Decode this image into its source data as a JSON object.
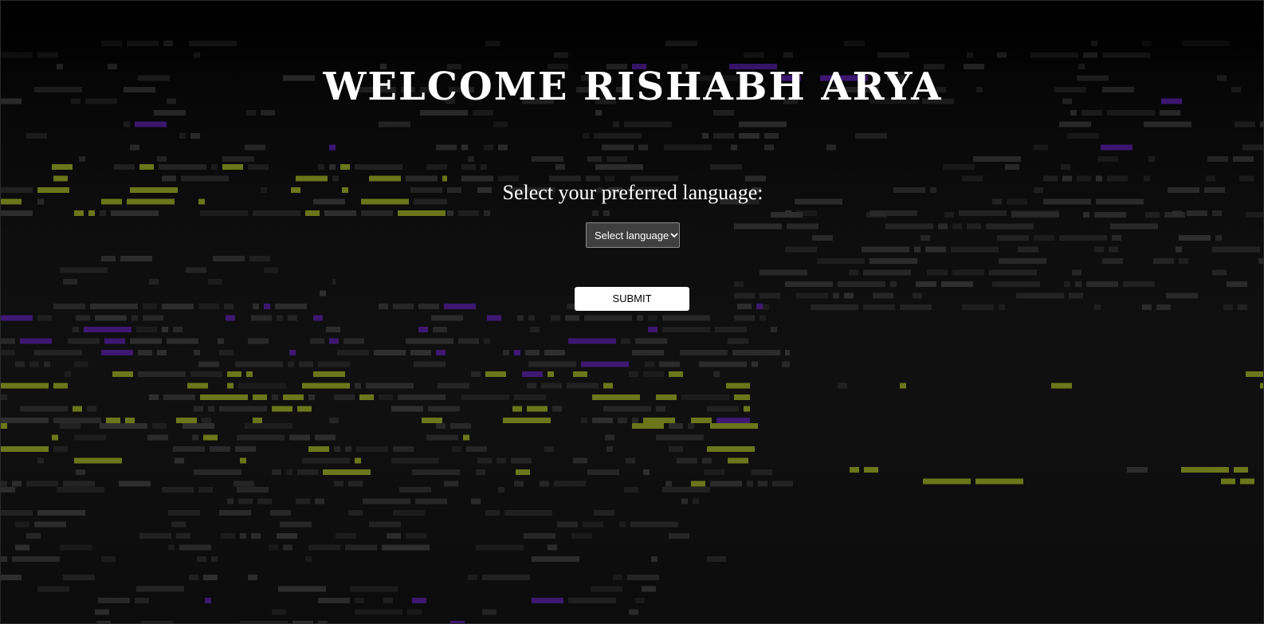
{
  "welcome": {
    "title": "WELCOME RISHABH ARYA"
  },
  "language_form": {
    "prompt": "Select your preferred language:",
    "select": {
      "selected": "Select language"
    },
    "submit_label": "SUBMIT"
  },
  "colors": {
    "background": "#000000",
    "text": "#ffffff",
    "pixel_gray": "#4a4a4a",
    "pixel_olive": "#8a9a1e",
    "pixel_violet": "#4a1a8a",
    "select_bg": "#3f3f3f",
    "button_bg": "#ffffff"
  },
  "icons": {
    "select_arrow": "chevron-down-icon"
  }
}
